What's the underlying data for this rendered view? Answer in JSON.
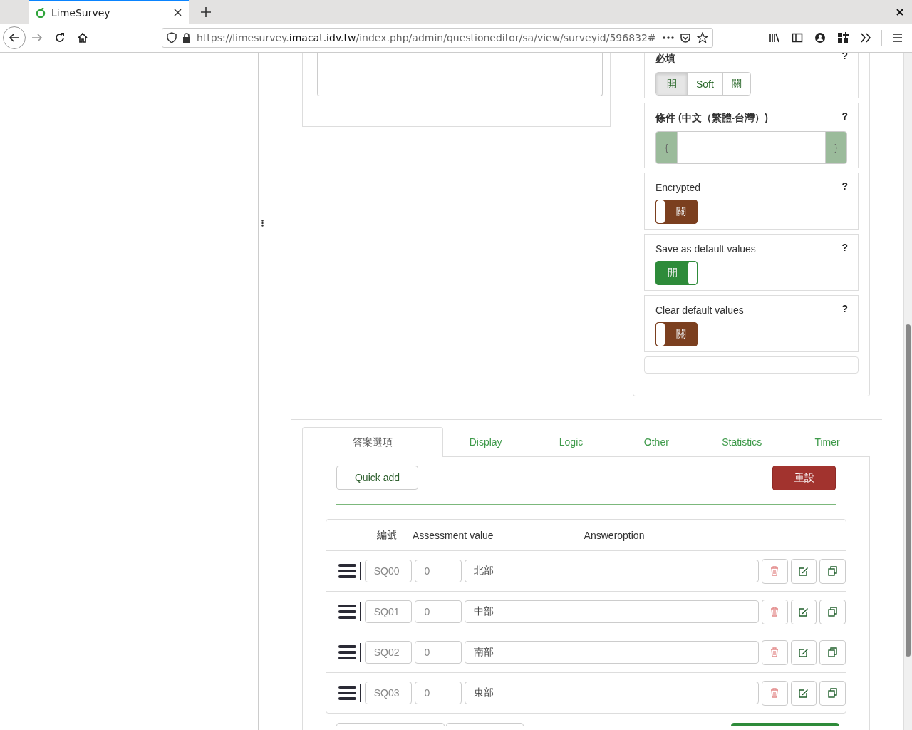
{
  "browser": {
    "tab_title": "LimeSurvey",
    "url_prefix": "https://limesurvey.",
    "url_domain": "imacat.idv.tw",
    "url_path": "/index.php/admin/questioneditor/sa/view/surveyid/596832#"
  },
  "settings": [
    {
      "kind": "segmented",
      "label": "必填",
      "help": "?",
      "options": [
        {
          "label": "開",
          "selected": true
        },
        {
          "label": "Soft",
          "selected": false
        },
        {
          "label": "關",
          "selected": false
        }
      ]
    },
    {
      "kind": "expression",
      "label": "條件 (中文（繁體-台灣）)",
      "help": "?",
      "open_brace": "{",
      "close_brace": "}"
    },
    {
      "kind": "toggle",
      "label": "Encrypted",
      "help": "?",
      "on": false,
      "state_text": "關"
    },
    {
      "kind": "toggle",
      "label": "Save as default values",
      "help": "?",
      "on": true,
      "state_text": "開"
    },
    {
      "kind": "toggle",
      "label": "Clear default values",
      "help": "?",
      "on": false,
      "state_text": "關"
    },
    {
      "kind": "empty"
    }
  ],
  "tabs": [
    {
      "label": "答案選項",
      "selected": true
    },
    {
      "label": "Display",
      "selected": false
    },
    {
      "label": "Logic",
      "selected": false
    },
    {
      "label": "Other",
      "selected": false
    },
    {
      "label": "Statistics",
      "selected": false
    },
    {
      "label": "Timer",
      "selected": false
    }
  ],
  "quick_add": "Quick add",
  "reset": "重設",
  "table": {
    "columns": [
      "編號",
      "Assessment value",
      "Answeroption"
    ],
    "rows": [
      {
        "code": "SQ00",
        "assessment": "0",
        "answer": "北部"
      },
      {
        "code": "SQ01",
        "assessment": "0",
        "answer": "中部"
      },
      {
        "code": "SQ02",
        "assessment": "0",
        "answer": "南部"
      },
      {
        "code": "SQ03",
        "assessment": "0",
        "answer": "東部"
      }
    ]
  }
}
